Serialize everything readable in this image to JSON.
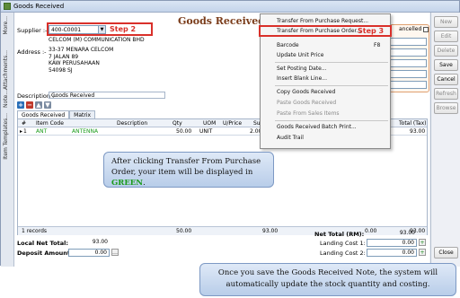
{
  "window": {
    "title": "Goods Received"
  },
  "vtabs": [
    "More...",
    "Attachments...",
    "Note...",
    "Item Templates..."
  ],
  "header": {
    "form_title": "Goods Received",
    "supplier_label": "Supplier :-",
    "supplier_code": "400-C0001",
    "step2": "Step 2",
    "supplier_name": "CELCOM (M) COMMUNICATION BHD",
    "address_label": "Address :-",
    "address_lines": [
      "33-37 MENARA CELCOM",
      "7 JALAN 89",
      "KAW PERUSAHAAN",
      "54098 SJ"
    ],
    "description_label": "Description :-",
    "description": "Goods Received",
    "cancelled_label": "ancelled",
    "right_fields": [
      "",
      "018",
      "",
      "",
      ""
    ]
  },
  "menu": {
    "items": [
      {
        "label": "Transfer From Purchase Request...",
        "enabled": true
      },
      {
        "label": "Transfer From Purchase Order...",
        "enabled": true,
        "step": "Step 3"
      },
      {
        "label": "Barcode",
        "shortcut": "F8",
        "enabled": true
      },
      {
        "label": "Update Unit Price",
        "enabled": true
      },
      {
        "label": "Set Posting Date...",
        "enabled": true
      },
      {
        "label": "Insert Blank Line...",
        "enabled": true
      },
      {
        "label": "Copy Goods Received",
        "enabled": true
      },
      {
        "label": "Paste Goods Received",
        "enabled": false
      },
      {
        "label": "Paste From Sales Items",
        "enabled": false
      },
      {
        "label": "Goods Received Batch Print...",
        "enabled": true
      },
      {
        "label": "Audit Trail",
        "enabled": true
      }
    ]
  },
  "tabs": [
    "Goods Received",
    "Matrix"
  ],
  "grid": {
    "columns": [
      "Item Code",
      "Description",
      "Qty",
      "UOM",
      "U/Price",
      "Sub To",
      "Total (Tax)"
    ],
    "rows": [
      {
        "num": "1",
        "item_code": "ANT",
        "description": "ANTENNA",
        "qty": "50.00",
        "uom": "UNIT",
        "uprice": "2.00",
        "total_tax": "93.00"
      }
    ],
    "footer": {
      "records": "1 records",
      "qty": "50.00",
      "subtotal": "93.00",
      "tax": "0.00",
      "total": "93.00"
    }
  },
  "callout1": {
    "text": "After clicking Transfer From Purchase Order, your item will be displayed in ",
    "green": "GREEN",
    "end": "."
  },
  "callout2": {
    "text": "Once you save the Goods Received Note, the system will automatically update the stock quantity and costing."
  },
  "bottom": {
    "local_net_total_label": "Local Net Total:",
    "local_net_total": "93.00",
    "deposit_label": "Deposit Amount:",
    "deposit": "0.00",
    "net_total_label": "Net Total (RM):",
    "net_total": "93.00",
    "landing1_label": "Landing Cost 1:",
    "landing1": "0.00",
    "landing2_label": "Landing Cost 2:",
    "landing2": "0.00"
  },
  "right_buttons": [
    "New",
    "Edit",
    "Delete",
    "Save",
    "Cancel",
    "Refresh",
    "Browse",
    "Close"
  ]
}
